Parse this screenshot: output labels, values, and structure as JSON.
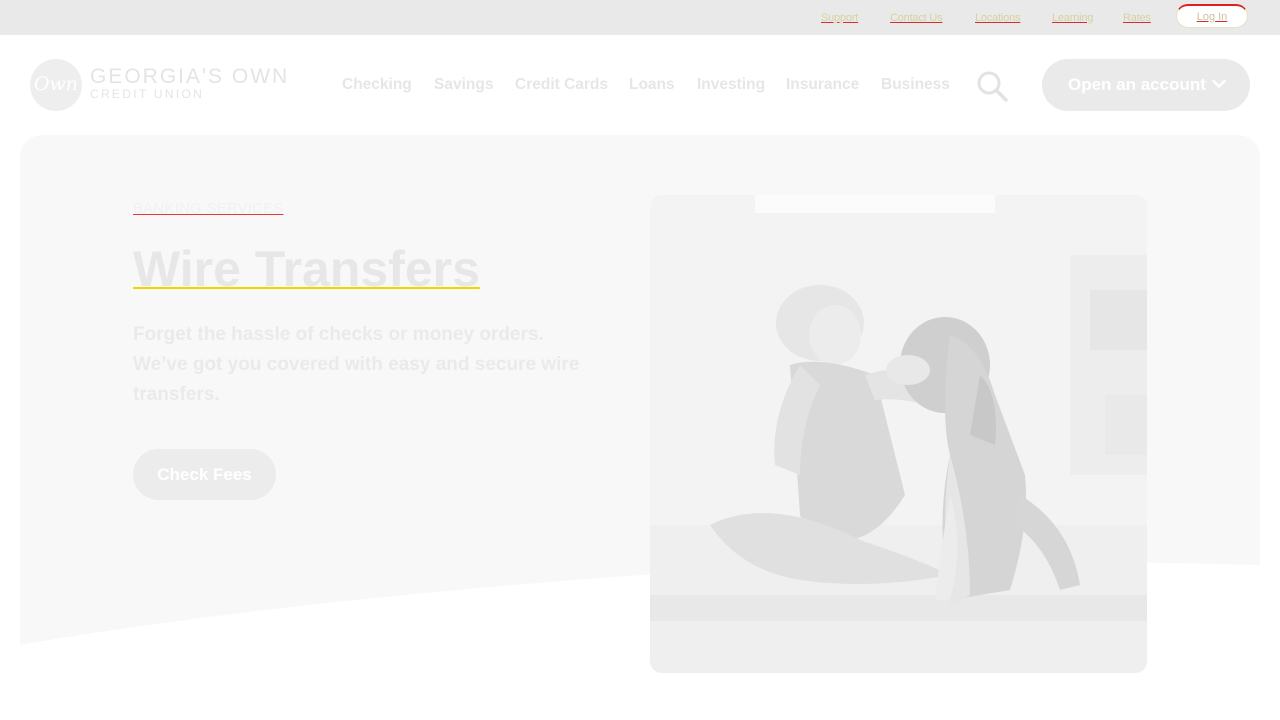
{
  "utility_nav": {
    "links": [
      {
        "label": "Support"
      },
      {
        "label": "Contact Us"
      },
      {
        "label": "Locations"
      },
      {
        "label": "Learning"
      },
      {
        "label": "Rates"
      }
    ],
    "login_label": "Log In"
  },
  "header": {
    "logo_mark": "Own",
    "logo_name": "GEORGIA'S OWN",
    "logo_subtitle": "CREDIT UNION",
    "nav": [
      {
        "label": "Checking"
      },
      {
        "label": "Savings"
      },
      {
        "label": "Credit Cards"
      },
      {
        "label": "Loans"
      },
      {
        "label": "Investing"
      },
      {
        "label": "Insurance"
      },
      {
        "label": "Business"
      }
    ],
    "search_icon": "search-icon",
    "cta_label": "Open an account",
    "cta_icon": "chevron-down-icon"
  },
  "hero": {
    "eyebrow": "BANKING SERVICES",
    "title": "Wire Transfers",
    "body": "Forget the hassle of checks or money orders. We’ve got you covered with easy and secure wire transfers.",
    "button_label": "Check Fees"
  },
  "colors": {
    "utility_bar_bg": "#e9e9e9",
    "hero_bg": "#f8f8f8",
    "button_bg": "#eaeaea",
    "accent_underline": "#e53935",
    "highlight_underline": "#f1d500"
  }
}
